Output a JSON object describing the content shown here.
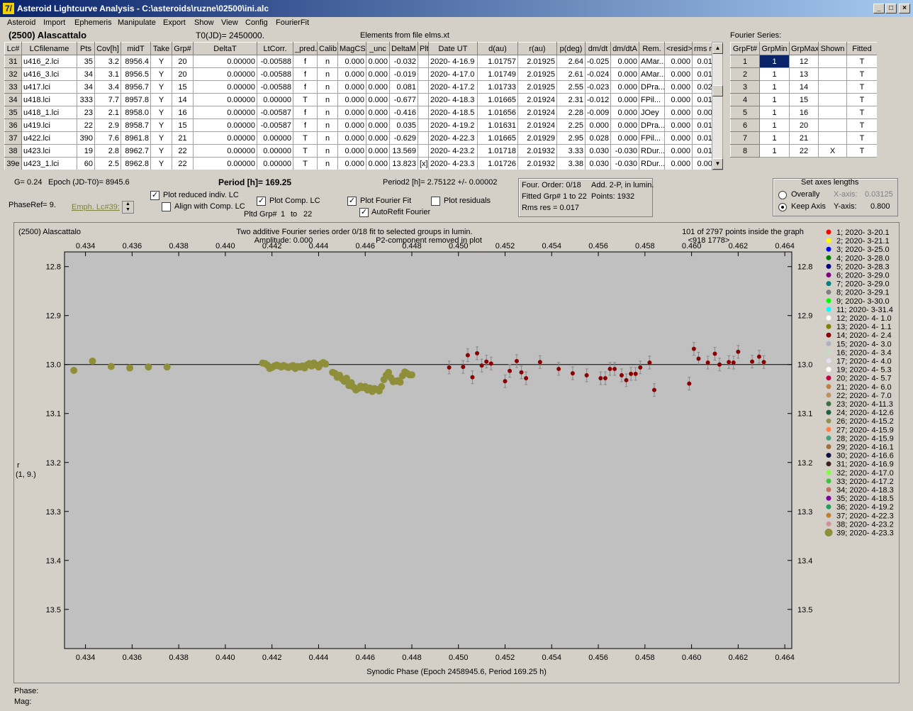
{
  "window": {
    "title": "Asteroid Lightcurve Analysis - C:\\asteroids\\ruzne\\02500\\ini.alc",
    "icon_glyph": "7/",
    "min_label": "_",
    "max_label": "□",
    "close_label": "×"
  },
  "menu": [
    "Asteroid",
    "Import",
    "Ephemeris",
    "Manipulate",
    "Export",
    "Show",
    "View",
    "Config",
    "FourierFit"
  ],
  "header": {
    "asteroid_name": "(2500) Alascattalo",
    "t0": "T0(JD)= 2450000.",
    "elements": "Elements from file elms.xt",
    "fourier_series_label": "Fourier Series:"
  },
  "lc_table": {
    "columns": [
      "Lc#",
      "LCfilename",
      "Pts",
      "Cov[h]",
      "midT",
      "Take",
      "Grp#",
      "DeltaT",
      "LtCorr.",
      "_pred.",
      "Calib.",
      "MagCS",
      "_unc",
      "DeltaM",
      "Plt",
      "Date UT",
      "d(au)",
      "r(au)",
      "p(deg)",
      "dm/dt",
      "dm/dtA",
      "Rem.",
      "<resid>",
      "rms res"
    ],
    "rows": [
      [
        "31",
        "u416_2.lci",
        "35",
        "3.2",
        "8956.4",
        "Y",
        "20",
        "0.00000",
        "-0.00588",
        "f",
        "n",
        "0.000",
        "0.000",
        "-0.032",
        "",
        "2020- 4-16.9",
        "1.01757",
        "2.01925",
        "2.64",
        "-0.025",
        "0.000",
        "AMar...",
        "0.000",
        "0.015"
      ],
      [
        "32",
        "u416_3.lci",
        "34",
        "3.1",
        "8956.5",
        "Y",
        "20",
        "0.00000",
        "-0.00588",
        "f",
        "n",
        "0.000",
        "0.000",
        "-0.019",
        "",
        "2020- 4-17.0",
        "1.01749",
        "2.01925",
        "2.61",
        "-0.024",
        "0.000",
        "AMar...",
        "0.000",
        "0.018"
      ],
      [
        "33",
        "u417.lci",
        "34",
        "3.4",
        "8956.7",
        "Y",
        "15",
        "0.00000",
        "-0.00588",
        "f",
        "n",
        "0.000",
        "0.000",
        "0.081",
        "",
        "2020- 4-17.2",
        "1.01733",
        "2.01925",
        "2.55",
        "-0.023",
        "0.000",
        "DPra...",
        "0.000",
        "0.021"
      ],
      [
        "34",
        "u418.lci",
        "333",
        "7.7",
        "8957.8",
        "Y",
        "14",
        "0.00000",
        "0.00000",
        "T",
        "n",
        "0.000",
        "0.000",
        "-0.677",
        "",
        "2020- 4-18.3",
        "1.01665",
        "2.01924",
        "2.31",
        "-0.012",
        "0.000",
        "FPil...",
        "0.000",
        "0.018"
      ],
      [
        "35",
        "u418_1.lci",
        "23",
        "2.1",
        "8958.0",
        "Y",
        "16",
        "0.00000",
        "-0.00587",
        "f",
        "n",
        "0.000",
        "0.000",
        "-0.416",
        "",
        "2020- 4-18.5",
        "1.01656",
        "2.01924",
        "2.28",
        "-0.009",
        "0.000",
        "JOey",
        "0.000",
        "0.009"
      ],
      [
        "36",
        "u419.lci",
        "22",
        "2.9",
        "8958.7",
        "Y",
        "15",
        "0.00000",
        "-0.00587",
        "f",
        "n",
        "0.000",
        "0.000",
        "0.035",
        "",
        "2020- 4-19.2",
        "1.01631",
        "2.01924",
        "2.25",
        "0.000",
        "0.000",
        "DPra...",
        "0.000",
        "0.014"
      ],
      [
        "37",
        "u422.lci",
        "390",
        "7.6",
        "8961.8",
        "Y",
        "21",
        "0.00000",
        "0.00000",
        "T",
        "n",
        "0.000",
        "0.000",
        "-0.629",
        "",
        "2020- 4-22.3",
        "1.01665",
        "2.01929",
        "2.95",
        "0.028",
        "0.000",
        "FPil...",
        "0.000",
        "0.014"
      ],
      [
        "38",
        "u423.lci",
        "19",
        "2.8",
        "8962.7",
        "Y",
        "22",
        "0.00000",
        "0.00000",
        "T",
        "n",
        "0.000",
        "0.000",
        "13.569",
        "",
        "2020- 4-23.2",
        "1.01718",
        "2.01932",
        "3.33",
        "0.030",
        "-0.030",
        "RDur...",
        "0.000",
        "0.013"
      ],
      [
        "39e",
        "u423_1.lci",
        "60",
        "2.5",
        "8962.8",
        "Y",
        "22",
        "0.00000",
        "0.00000",
        "T",
        "n",
        "0.000",
        "0.000",
        "13.823",
        "[x]",
        "2020- 4-23.3",
        "1.01726",
        "2.01932",
        "3.38",
        "0.030",
        "-0.030",
        "RDur...",
        "0.000",
        "0.006"
      ]
    ]
  },
  "fourier_table": {
    "columns": [
      "GrpFt#",
      "GrpMin",
      "GrpMax",
      "Shown",
      "Fitted"
    ],
    "rows": [
      [
        "1",
        "1",
        "12",
        "",
        "T"
      ],
      [
        "2",
        "1",
        "13",
        "",
        "T"
      ],
      [
        "3",
        "1",
        "14",
        "",
        "T"
      ],
      [
        "4",
        "1",
        "15",
        "",
        "T"
      ],
      [
        "5",
        "1",
        "16",
        "",
        "T"
      ],
      [
        "6",
        "1",
        "20",
        "",
        "T"
      ],
      [
        "7",
        "1",
        "21",
        "",
        "T"
      ],
      [
        "8",
        "1",
        "22",
        "X",
        "T"
      ]
    ]
  },
  "info": {
    "g": "G= 0.24",
    "epoch": "Epoch (JD-T0)= 8945.6",
    "period": "Period [h]= 169.25",
    "period2": "Period2 [h]= 2.75122 +/- 0.00002",
    "phaseref": "PhaseRef= 9.",
    "emph": "Emph. Lc#39:",
    "plot_reduced": "Plot reduced indiv. LC",
    "align_comp": "Align with Comp. LC",
    "plot_comp": "Plot Comp. LC",
    "plot_fourier": "Plot Fourier Fit",
    "plot_residuals": "Plot residuals",
    "autorefit": "AutoRefit Fourier",
    "pltd_grp": "Pltd Grp#",
    "grp_from": "1",
    "grp_to_label": "to",
    "grp_to": "22",
    "four_order": "Four. Order:  0/18",
    "add2p": "Add. 2-P, in lumin.",
    "fitted_grp": "Fitted Grp# 1 to 22",
    "points": "Points: 1932",
    "rms": "Rms res      = 0.017",
    "axes_title": "Set axes lengths",
    "overally": "Overally",
    "keep_axis": "Keep Axis",
    "xaxis_label": "X-axis:",
    "xaxis_val": "0.03125",
    "yaxis_label": "Y-axis:",
    "yaxis_val": "0.800",
    "phase_status": "Phase:",
    "mag_status": "Mag:"
  },
  "checkboxes": {
    "plot_reduced": true,
    "align_comp": false,
    "plot_comp": true,
    "plot_fourier": true,
    "plot_residuals": false,
    "autorefit": true
  },
  "colors": {
    "olive": "#8f8f3a",
    "darkred": "#8b0000",
    "plot_bg": "#c0c0c0",
    "selected": "#0a246a"
  },
  "chart_data": {
    "type": "scatter",
    "title_left": "(2500) Alascattalo",
    "title_center1": "Two additive Fourier series order 0/18 fit to selected groups in lumin.",
    "title_center2": "Amplitude: 0.000",
    "title_center3": "P2-component removed in plot",
    "title_right1": "101 of 2797 points inside the graph",
    "title_right2": "<918    1778>",
    "xlabel": "Synodic Phase (Epoch 2458945.6, Period 169.25 h)",
    "ylabel1": "r",
    "ylabel2": "(1, 9.)",
    "xlim": [
      0.4331,
      0.4643
    ],
    "ylim": [
      12.77,
      13.58
    ],
    "ylim_inverted": true,
    "fit_line": 13.0,
    "xticks": [
      "0.434",
      "0.436",
      "0.438",
      "0.440",
      "0.442",
      "0.444",
      "0.446",
      "0.448",
      "0.450",
      "0.452",
      "0.454",
      "0.456",
      "0.458",
      "0.460",
      "0.462",
      "0.464"
    ],
    "yticks": [
      "12.8",
      "12.9",
      "13.0",
      "13.1",
      "13.2",
      "13.3",
      "13.4",
      "13.5"
    ],
    "series": [
      {
        "name": "39; 2020- 4-23.3",
        "color": "#8f8f3a",
        "radius": 5,
        "errors": false,
        "points": [
          [
            0.4335,
            13.012
          ],
          [
            0.4343,
            12.993
          ],
          [
            0.4351,
            13.004
          ],
          [
            0.4359,
            13.007
          ],
          [
            0.4367,
            13.005
          ],
          [
            0.4375,
            13.005
          ],
          [
            0.4416,
            12.997
          ],
          [
            0.4417,
            12.998
          ],
          [
            0.4418,
            13.001
          ],
          [
            0.4419,
            13.008
          ],
          [
            0.442,
            13.006
          ],
          [
            0.4421,
            13.003
          ],
          [
            0.4422,
            13.001
          ],
          [
            0.4423,
            13.003
          ],
          [
            0.4424,
            13.005
          ],
          [
            0.4425,
            13.002
          ],
          [
            0.4426,
            13.004
          ],
          [
            0.4427,
            13.006
          ],
          [
            0.4428,
            13.004
          ],
          [
            0.4429,
            13.002
          ],
          [
            0.443,
            13.008
          ],
          [
            0.4431,
            13.004
          ],
          [
            0.4432,
            13.005
          ],
          [
            0.4433,
            13.003
          ],
          [
            0.4434,
            13.007
          ],
          [
            0.4435,
            13.001
          ],
          [
            0.4436,
            12.998
          ],
          [
            0.4437,
            13.003
          ],
          [
            0.4438,
            12.997
          ],
          [
            0.4439,
            13.001
          ],
          [
            0.444,
            13.005
          ],
          [
            0.4441,
            12.999
          ],
          [
            0.4442,
            12.996
          ],
          [
            0.4443,
            12.999
          ],
          [
            0.4446,
            13.016
          ],
          [
            0.4447,
            13.018
          ],
          [
            0.4448,
            13.026
          ],
          [
            0.4449,
            13.022
          ],
          [
            0.445,
            13.029
          ],
          [
            0.4451,
            13.034
          ],
          [
            0.4452,
            13.028
          ],
          [
            0.4453,
            13.043
          ],
          [
            0.4454,
            13.037
          ],
          [
            0.4455,
            13.046
          ],
          [
            0.4456,
            13.052
          ],
          [
            0.4457,
            13.049
          ],
          [
            0.4458,
            13.044
          ],
          [
            0.4459,
            13.047
          ],
          [
            0.446,
            13.045
          ],
          [
            0.4461,
            13.052
          ],
          [
            0.4462,
            13.048
          ],
          [
            0.4463,
            13.055
          ],
          [
            0.4464,
            13.049
          ],
          [
            0.4465,
            13.051
          ],
          [
            0.4466,
            13.054
          ],
          [
            0.4467,
            13.045
          ],
          [
            0.4468,
            13.031
          ],
          [
            0.4469,
            13.022
          ],
          [
            0.447,
            13.016
          ],
          [
            0.4471,
            13.027
          ],
          [
            0.4472,
            13.035
          ],
          [
            0.4473,
            13.034
          ],
          [
            0.4474,
            13.033
          ],
          [
            0.4475,
            13.036
          ],
          [
            0.4476,
            13.023
          ],
          [
            0.4477,
            13.015
          ],
          [
            0.4478,
            13.018
          ],
          [
            0.4479,
            13.021
          ],
          [
            0.448,
            13.021
          ]
        ]
      },
      {
        "name": "14; 2020- 4- 2.4",
        "color": "#8b0000",
        "radius": 3,
        "errors": true,
        "points": [
          [
            0.4496,
            13.006
          ],
          [
            0.4502,
            13.005
          ],
          [
            0.4504,
            12.981
          ],
          [
            0.4506,
            13.026
          ],
          [
            0.4508,
            12.977
          ],
          [
            0.451,
            13.002
          ],
          [
            0.4512,
            12.994
          ],
          [
            0.4514,
            12.998
          ],
          [
            0.452,
            13.034
          ],
          [
            0.4522,
            13.013
          ],
          [
            0.4525,
            12.993
          ],
          [
            0.4527,
            13.016
          ],
          [
            0.4529,
            13.028
          ],
          [
            0.4535,
            12.995
          ],
          [
            0.4543,
            13.009
          ],
          [
            0.4549,
            13.018
          ],
          [
            0.4555,
            13.022
          ],
          [
            0.4561,
            13.028
          ],
          [
            0.4563,
            13.028
          ],
          [
            0.4565,
            13.009
          ],
          [
            0.4567,
            13.009
          ],
          [
            0.457,
            13.022
          ],
          [
            0.4572,
            13.032
          ],
          [
            0.4574,
            13.019
          ],
          [
            0.4576,
            13.019
          ],
          [
            0.4578,
            13.006
          ],
          [
            0.4582,
            12.996
          ],
          [
            0.4584,
            13.052
          ],
          [
            0.4599,
            13.039
          ],
          [
            0.4601,
            12.968
          ],
          [
            0.4603,
            12.988
          ],
          [
            0.4607,
            12.996
          ],
          [
            0.461,
            12.978
          ],
          [
            0.4612,
            13.0
          ],
          [
            0.4616,
            12.995
          ],
          [
            0.4618,
            12.996
          ],
          [
            0.462,
            12.974
          ],
          [
            0.4626,
            12.994
          ],
          [
            0.4629,
            12.984
          ],
          [
            0.4631,
            12.995
          ]
        ]
      }
    ]
  },
  "legend": [
    {
      "label": "1; 2020- 3-20.1",
      "color": "#ff0000"
    },
    {
      "label": "2; 2020- 3-21.1",
      "color": "#ffff00"
    },
    {
      "label": "3; 2020- 3-25.0",
      "color": "#0000ff"
    },
    {
      "label": "4; 2020- 3-28.0",
      "color": "#008000"
    },
    {
      "label": "5; 2020- 3-28.3",
      "color": "#000080"
    },
    {
      "label": "6; 2020- 3-29.0",
      "color": "#800080"
    },
    {
      "label": "7; 2020- 3-29.0",
      "color": "#008080"
    },
    {
      "label": "8; 2020- 3-29.1",
      "color": "#808080"
    },
    {
      "label": "9; 2020- 3-30.0",
      "color": "#00ff00"
    },
    {
      "label": "11; 2020- 3-31.4",
      "color": "#00ffff"
    },
    {
      "label": "12; 2020- 4- 1.0",
      "color": "#ffffff"
    },
    {
      "label": "13; 2020- 4- 1.1",
      "color": "#808000"
    },
    {
      "label": "14; 2020- 4- 2.4",
      "color": "#8b0000"
    },
    {
      "label": "15; 2020- 4- 3.0",
      "color": "#b0b0c0"
    },
    {
      "label": "16; 2020- 4- 3.4",
      "color": "#c0e0c0"
    },
    {
      "label": "17; 2020- 4- 4.0",
      "color": "#e0e0f0"
    },
    {
      "label": "19; 2020- 4- 5.3",
      "color": "#ffffff"
    },
    {
      "label": "20; 2020- 4- 5.7",
      "color": "#c00040"
    },
    {
      "label": "21; 2020- 4- 6.0",
      "color": "#c08040"
    },
    {
      "label": "22; 2020- 4- 7.0",
      "color": "#c09060"
    },
    {
      "label": "23; 2020- 4-11.3",
      "color": "#407040"
    },
    {
      "label": "24; 2020- 4-12.6",
      "color": "#206040"
    },
    {
      "label": "26; 2020- 4-15.2",
      "color": "#909050"
    },
    {
      "label": "27; 2020- 4-15.9",
      "color": "#ff8040"
    },
    {
      "label": "28; 2020- 4-15.9",
      "color": "#40a080"
    },
    {
      "label": "29; 2020- 4-16.1",
      "color": "#a07040"
    },
    {
      "label": "30; 2020- 4-16.6",
      "color": "#101040"
    },
    {
      "label": "31; 2020- 4-16.9",
      "color": "#402020"
    },
    {
      "label": "32; 2020- 4-17.0",
      "color": "#80ff40"
    },
    {
      "label": "33; 2020- 4-17.2",
      "color": "#40c040"
    },
    {
      "label": "34; 2020- 4-18.3",
      "color": "#c07060"
    },
    {
      "label": "35; 2020- 4-18.5",
      "color": "#8000a0"
    },
    {
      "label": "36; 2020- 4-19.2",
      "color": "#20a060"
    },
    {
      "label": "37; 2020- 4-22.3",
      "color": "#c08030"
    },
    {
      "label": "38; 2020- 4-23.2",
      "color": "#d090a0"
    },
    {
      "label": "39; 2020- 4-23.3",
      "color": "#8f8f3a"
    }
  ]
}
